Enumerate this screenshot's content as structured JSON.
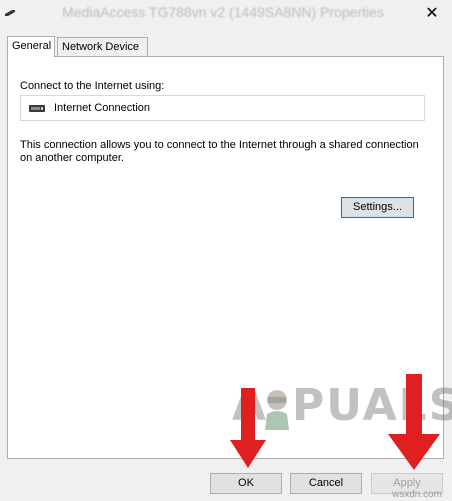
{
  "window": {
    "title": "MediaAccess TG788vn v2 (1449SA8NN) Properties",
    "close_glyph": "✕"
  },
  "tabs": [
    {
      "label": "General",
      "active": true
    },
    {
      "label": "Network Device",
      "active": false
    }
  ],
  "general": {
    "connect_label": "Connect to the Internet using:",
    "connection_name": "Internet Connection",
    "description": "This connection allows you to connect to the Internet through a shared connection on another computer.",
    "settings_label": "Settings..."
  },
  "footer": {
    "ok_label": "OK",
    "cancel_label": "Cancel",
    "apply_label": "Apply"
  },
  "annotation": {
    "arrow_color": "#e02020"
  },
  "watermark": {
    "text_a": "A",
    "text_rest": "PUALS",
    "site": "wsxdn.com"
  }
}
